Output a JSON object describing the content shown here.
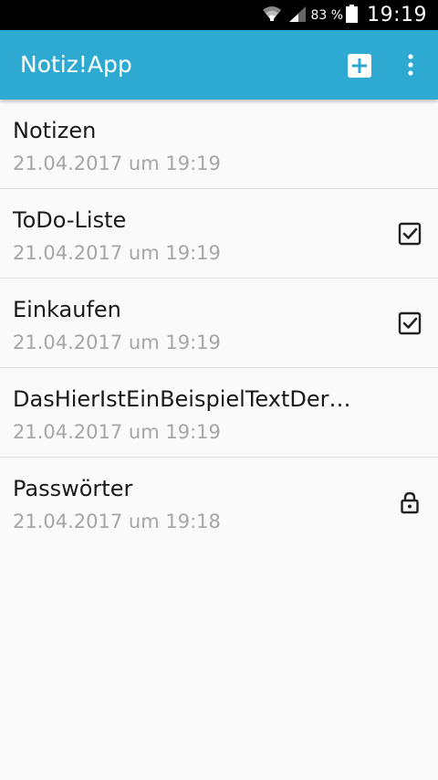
{
  "status_bar": {
    "battery_percent": "83 %",
    "time": "19:19",
    "icons": [
      "wifi-icon",
      "signal-icon",
      "battery-icon"
    ]
  },
  "app_bar": {
    "title": "Notiz!App",
    "actions": [
      "add-icon",
      "overflow-menu-icon"
    ],
    "color": "#2eaad2"
  },
  "notes": [
    {
      "title": "Notizen",
      "date": "21.04.2017 um 19:19",
      "icon": ""
    },
    {
      "title": "ToDo-Liste",
      "date": "21.04.2017 um 19:19",
      "icon": "checkbox-icon"
    },
    {
      "title": "Einkaufen",
      "date": "21.04.2017 um 19:19",
      "icon": "checkbox-icon"
    },
    {
      "title": "DasHierIstEinBeispielTextDer…",
      "date": "21.04.2017 um 19:19",
      "icon": ""
    },
    {
      "title": "Passwörter",
      "date": "21.04.2017 um 19:18",
      "icon": "lock-icon"
    }
  ]
}
